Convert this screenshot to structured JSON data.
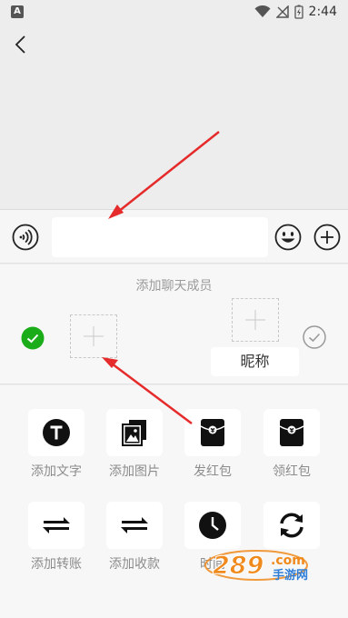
{
  "status_bar": {
    "left_icon": "A",
    "time": "2:44",
    "icons": [
      "wifi-icon",
      "signal-icon",
      "battery-charging-icon"
    ]
  },
  "nav": {
    "back_icon": "chevron-left-icon"
  },
  "input_bar": {
    "voice_icon": "voice-icon",
    "text_value": "",
    "emoji_icon": "emoji-icon",
    "plus_icon": "plus-circle-icon"
  },
  "members": {
    "title": "添加聊天成员",
    "nickname_label": "昵称"
  },
  "actions": [
    {
      "label": "添加文字",
      "icon": "text-t-icon"
    },
    {
      "label": "添加图片",
      "icon": "image-icon"
    },
    {
      "label": "发红包",
      "icon": "red-packet-icon"
    },
    {
      "label": "领红包",
      "icon": "red-packet-icon"
    },
    {
      "label": "添加转账",
      "icon": "transfer-icon"
    },
    {
      "label": "添加收款",
      "icon": "receive-icon"
    },
    {
      "label": "时间",
      "icon": "clock-icon"
    },
    {
      "label": "",
      "icon": "refresh-icon"
    }
  ],
  "watermark": {
    "brand": "289",
    "domain": ".com",
    "subtitle": "手游网"
  },
  "colors": {
    "background": "#ededed",
    "panel": "#f7f7f7",
    "accent_green": "#1aad19",
    "arrow_red": "#e52b2b",
    "watermark_orange": "#f08a1c",
    "watermark_blue": "#2f7fd8"
  }
}
